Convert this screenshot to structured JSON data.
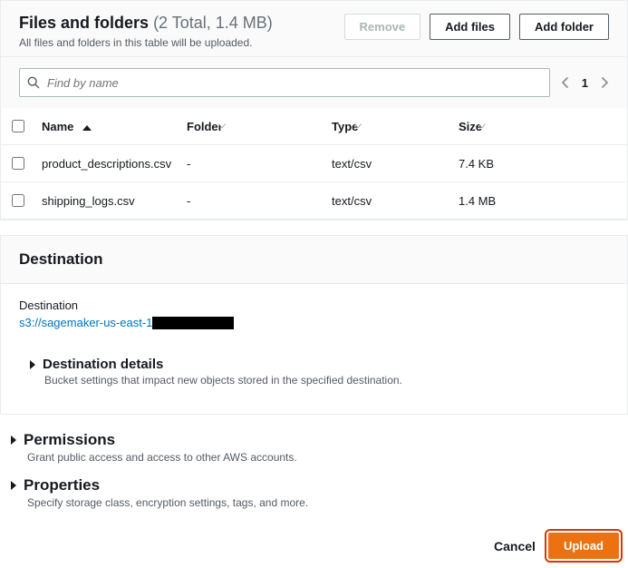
{
  "filesPanel": {
    "title": "Files and folders",
    "count_text": "(2 Total, 1.4 MB)",
    "subtitle": "All files and folders in this table will be uploaded.",
    "buttons": {
      "remove": "Remove",
      "add_files": "Add files",
      "add_folder": "Add folder"
    },
    "search_placeholder": "Find by name",
    "page_number": "1",
    "columns": {
      "name": "Name",
      "folder": "Folder",
      "type": "Type",
      "size": "Size"
    },
    "rows": [
      {
        "name": "product_descriptions.csv",
        "folder": "-",
        "type": "text/csv",
        "size": "7.4 KB"
      },
      {
        "name": "shipping_logs.csv",
        "folder": "-",
        "type": "text/csv",
        "size": "1.4 MB"
      }
    ]
  },
  "destinationPanel": {
    "title": "Destination",
    "label": "Destination",
    "link_prefix": "s3://sagemaker-us-east-1",
    "details": {
      "title": "Destination details",
      "desc": "Bucket settings that impact new objects stored in the specified destination."
    }
  },
  "permissions": {
    "title": "Permissions",
    "desc": "Grant public access and access to other AWS accounts."
  },
  "properties": {
    "title": "Properties",
    "desc": "Specify storage class, encryption settings, tags, and more."
  },
  "footer": {
    "cancel": "Cancel",
    "upload": "Upload"
  }
}
